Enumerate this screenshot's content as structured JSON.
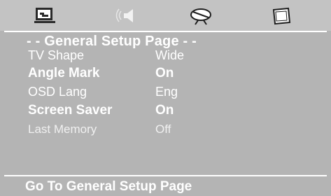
{
  "tabs": [
    {
      "icon": "general-setup-icon",
      "active": true
    },
    {
      "icon": "audio-setup-icon",
      "active": false
    },
    {
      "icon": "video-setup-icon",
      "active": false
    },
    {
      "icon": "preference-icon",
      "active": false
    }
  ],
  "page_title": "- - General Setup Page - -",
  "settings": [
    {
      "label": "TV Shape",
      "value": "Wide"
    },
    {
      "label": "Angle Mark",
      "value": "On"
    },
    {
      "label": "OSD Lang",
      "value": "Eng"
    },
    {
      "label": "Screen Saver",
      "value": "On"
    },
    {
      "label": "Last Memory",
      "value": "Off"
    }
  ],
  "footer_text": "Go To General Setup Page",
  "colors": {
    "background": "#b4b4b4",
    "toolbar": "#c3c3c3",
    "text": "#ffffff"
  }
}
